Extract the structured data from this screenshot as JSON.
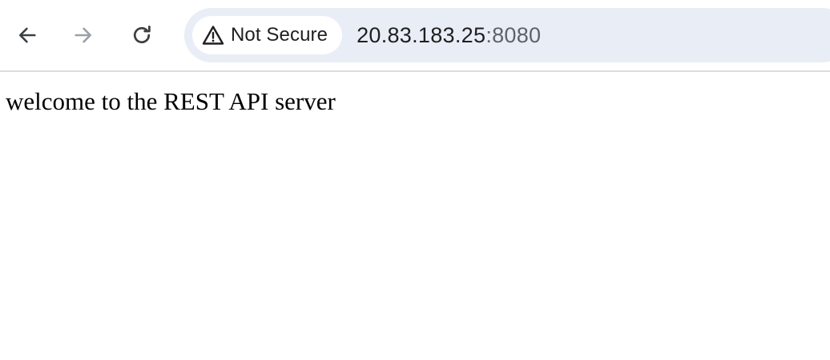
{
  "toolbar": {
    "back_icon": "arrow-left-icon",
    "forward_icon": "arrow-right-icon",
    "reload_icon": "reload-icon",
    "security": {
      "icon": "warning-triangle-icon",
      "label": "Not Secure"
    },
    "url": {
      "host": "20.83.183.25",
      "port": ":8080"
    },
    "colors": {
      "omnibox_bg": "#e9edf6",
      "chip_bg": "#ffffff",
      "icon_active": "#3c4043",
      "icon_disabled": "#9aa0a6"
    }
  },
  "page": {
    "body_text": "welcome to the REST API server"
  }
}
